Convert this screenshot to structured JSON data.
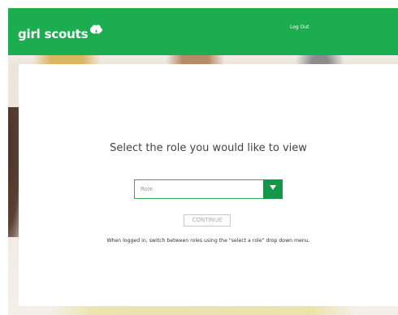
{
  "header": {
    "brand": "girl scouts",
    "logout_label": "Log Out"
  },
  "main": {
    "title": "Select the role you would like to view",
    "role_select": {
      "value": "Role"
    },
    "continue_label": "CONTINUE",
    "help_text": "When logged in, switch between roles using the \"select a role\" drop down menu."
  },
  "colors": {
    "brand_green": "#1cad51",
    "dropdown_green": "#15974a"
  },
  "icons": {
    "logo_mark": "trefoil-icon",
    "dropdown": "chevron-down-icon"
  }
}
